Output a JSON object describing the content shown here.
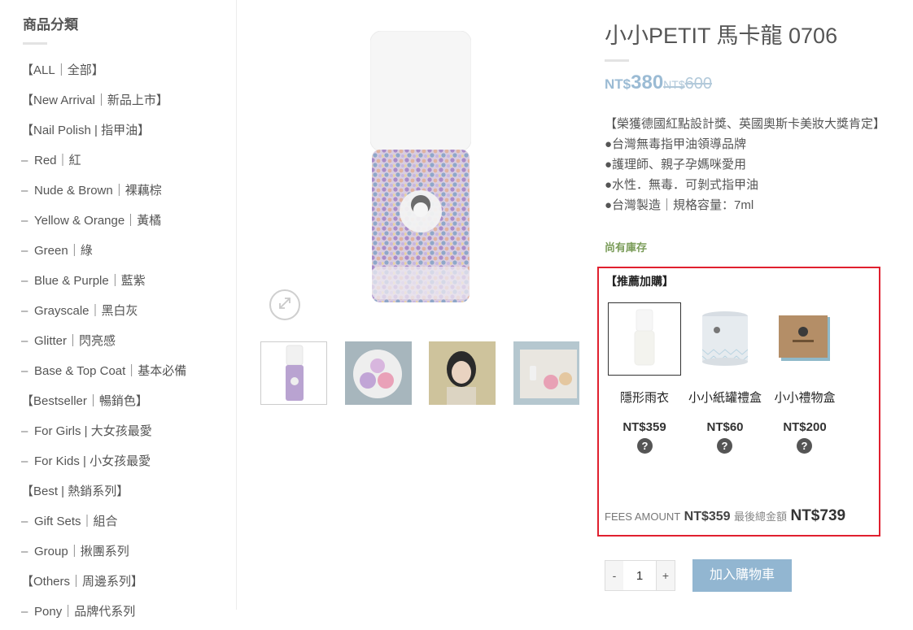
{
  "sidebar": {
    "title": "商品分類",
    "items": [
      {
        "label": "【ALL｜全部】",
        "sub": false
      },
      {
        "label": "【New Arrival｜新品上市】",
        "sub": false
      },
      {
        "label": "【Nail Polish | 指甲油】",
        "sub": false
      },
      {
        "label": "Red｜紅",
        "sub": true
      },
      {
        "label": "Nude & Brown｜裸藕棕",
        "sub": true
      },
      {
        "label": "Yellow & Orange｜黃橘",
        "sub": true
      },
      {
        "label": "Green｜綠",
        "sub": true
      },
      {
        "label": "Blue & Purple｜藍紫",
        "sub": true
      },
      {
        "label": "Grayscale｜黑白灰",
        "sub": true
      },
      {
        "label": "Glitter｜閃亮感",
        "sub": true
      },
      {
        "label": "Base & Top Coat｜基本必備",
        "sub": true
      },
      {
        "label": "【Bestseller｜暢銷色】",
        "sub": false
      },
      {
        "label": "For Girls | 大女孩最愛",
        "sub": true
      },
      {
        "label": "For Kids | 小女孩最愛",
        "sub": true
      },
      {
        "label": "【Best | 熱銷系列】",
        "sub": false
      },
      {
        "label": "Gift Sets｜組合",
        "sub": true
      },
      {
        "label": "Group｜揪團系列",
        "sub": true
      },
      {
        "label": "【Others｜周邊系列】",
        "sub": false
      },
      {
        "label": "Pony｜品牌代系列",
        "sub": true
      }
    ]
  },
  "product": {
    "title": "小小PETIT 馬卡龍 0706",
    "currency": "NT$",
    "price": "380",
    "old_currency": "NT$",
    "old_price": "600",
    "description": [
      "【榮獲德國紅點設計獎、英國奧斯卡美妝大獎肯定】",
      "●台灣無毒指甲油領導品牌",
      "●護理師、親子孕媽咪愛用",
      "●水性．無毒．可剝式指甲油",
      "●台灣製造｜規格容量：7ml"
    ],
    "stock": "尚有庫存"
  },
  "recommend": {
    "title": "【推薦加購】",
    "items": [
      {
        "name": "隱形雨衣",
        "price": "NT$359",
        "icon": "question-icon"
      },
      {
        "name": "小小紙罐禮盒",
        "price": "NT$60",
        "icon": "question-icon"
      },
      {
        "name": "小小禮物盒",
        "price": "NT$200",
        "icon": "question-icon"
      }
    ],
    "fees_label": "FEES AMOUNT",
    "fees_value": "NT$359",
    "total_label": "最後總金額",
    "total_value": "NT$739"
  },
  "cart": {
    "minus": "-",
    "quantity": "1",
    "plus": "+",
    "add_label": "加入購物車"
  },
  "colors": {
    "price": "#9bbbd4",
    "stock": "#7a9c59",
    "recommend_border": "#e0202f",
    "add_button": "#92b6d1"
  }
}
